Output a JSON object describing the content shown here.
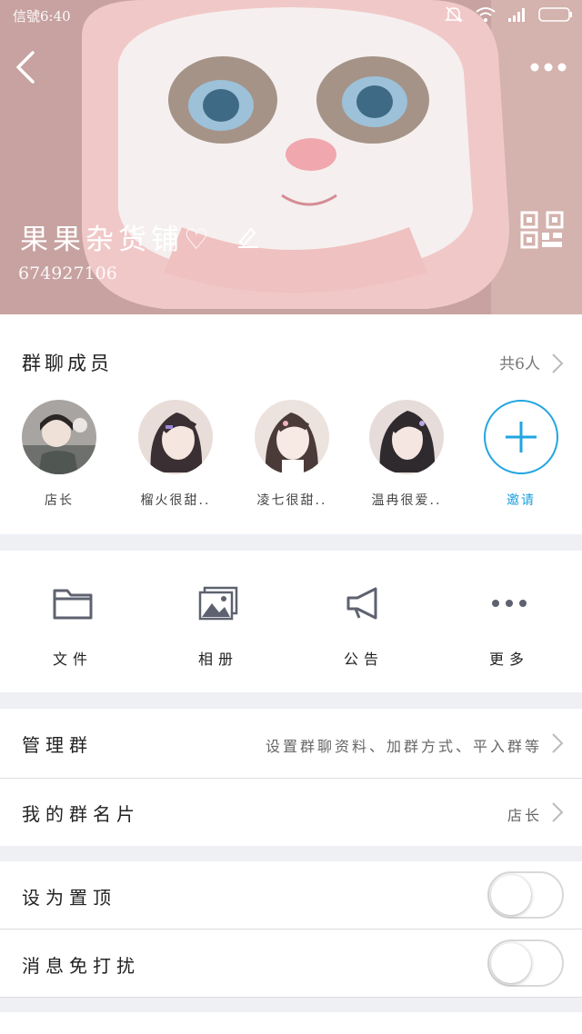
{
  "status_bar": {
    "carrier_time": "信號6:40"
  },
  "header": {
    "group_name": "果果杂货铺♡",
    "group_id": "674927106"
  },
  "members": {
    "title": "群聊成员",
    "count": "共6人",
    "list": [
      {
        "name": "店长"
      },
      {
        "name": "榴火很甜.."
      },
      {
        "name": "凌七很甜.."
      },
      {
        "name": "温冉很爱.."
      }
    ],
    "invite_label": "邀请"
  },
  "actions": [
    {
      "label": "文件",
      "icon": "folder-icon"
    },
    {
      "label": "相册",
      "icon": "album-icon"
    },
    {
      "label": "公告",
      "icon": "megaphone-icon"
    },
    {
      "label": "更多",
      "icon": "more-dots-icon"
    }
  ],
  "settings": {
    "manage": {
      "label": "管理群",
      "value": "设置群聊资料、加群方式、平入群等"
    },
    "card": {
      "label": "我的群名片",
      "value": "店长"
    },
    "pin": {
      "label": "设为置顶",
      "on": false
    },
    "mute": {
      "label": "消息免打扰",
      "on": false
    }
  },
  "colors": {
    "accent": "#22a6e0",
    "header_bg": "#c9a6a6",
    "page_bg": "#eef0f4",
    "icon_gray": "#5e6270"
  }
}
